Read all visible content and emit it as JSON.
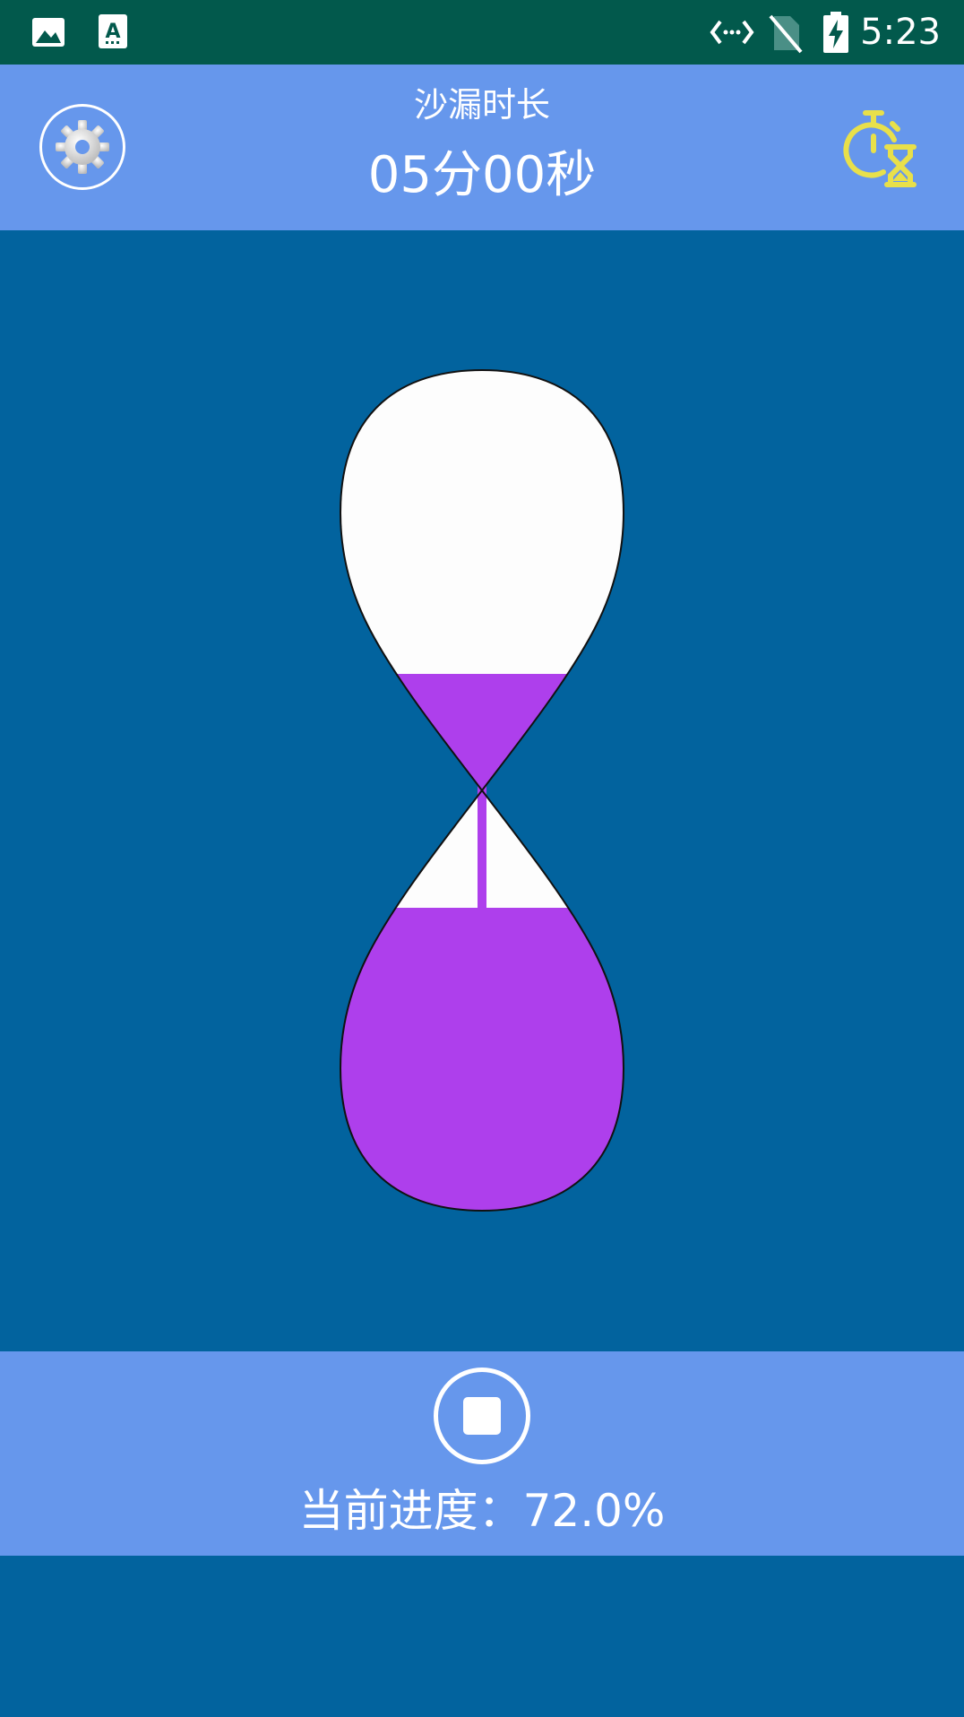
{
  "status_bar": {
    "time": "5:23",
    "icons": [
      "image-icon",
      "text-a-icon",
      "code-icon",
      "no-sim-icon",
      "battery-charging-icon"
    ]
  },
  "header": {
    "title": "沙漏时长",
    "duration": "05分00秒",
    "settings_icon": "gear-icon",
    "timer_icon": "stopwatch-hourglass-icon"
  },
  "hourglass": {
    "progress_fraction": 0.72,
    "sand_color": "#ae3fec",
    "glass_color": "#fdfdfd",
    "background_color": "#02639e"
  },
  "footer": {
    "stop_icon": "stop-icon",
    "progress_label": "当前进度：72.0%"
  },
  "colors": {
    "status_bar": "#02594c",
    "bars": "#6697ec",
    "accent_yellow": "#e8e04a"
  }
}
